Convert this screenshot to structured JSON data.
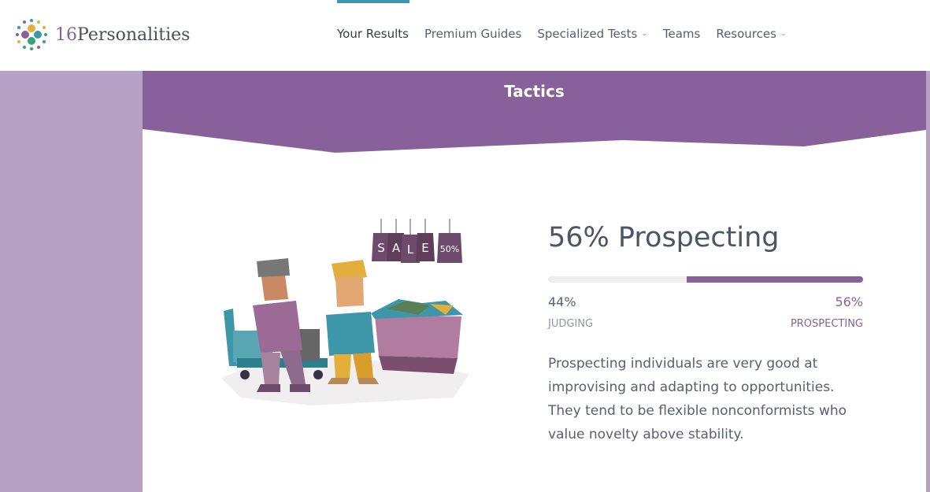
{
  "brand": {
    "number": "16",
    "name": "Personalities"
  },
  "nav": {
    "items": [
      {
        "label": "Your Results",
        "dropdown": false,
        "active": true
      },
      {
        "label": "Premium Guides",
        "dropdown": false,
        "active": false
      },
      {
        "label": "Specialized Tests",
        "dropdown": true,
        "active": false
      },
      {
        "label": "Teams",
        "dropdown": false,
        "active": false
      },
      {
        "label": "Resources",
        "dropdown": true,
        "active": false
      }
    ]
  },
  "section": {
    "title": "Tactics",
    "result_title": "56% Prospecting",
    "left_percent": "44%",
    "right_percent": "56%",
    "right_fill_fraction": 0.56,
    "left_label": "JUDGING",
    "right_label": "PROSPECTING",
    "description": "Prospecting individuals are very good at improvising and adapting to opportunities. They tend to be flexible nonconformists who value novelty above stability."
  },
  "illustration": {
    "sign_letters": [
      "S",
      "A",
      "L",
      "E"
    ],
    "discount_tag": "50%"
  },
  "colors": {
    "accent": "#88619a",
    "side_band": "#b7a1c5",
    "nav_indicator": "#3d97a8",
    "text": "#576071"
  }
}
